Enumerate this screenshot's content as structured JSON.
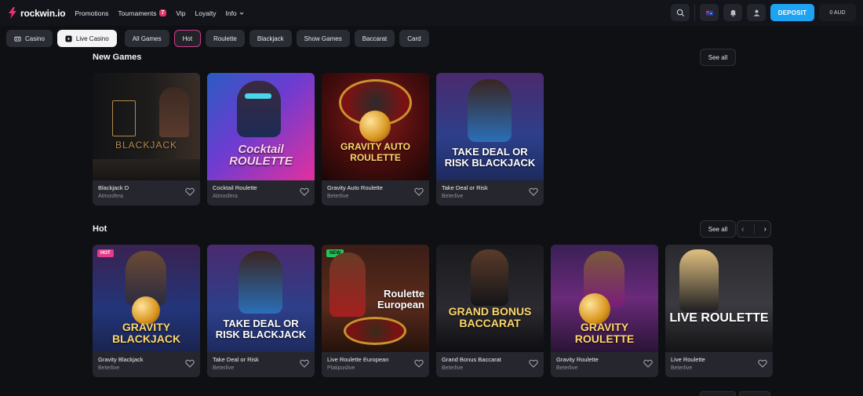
{
  "brand": {
    "name": "rockwin.io",
    "accent": "#e5336e",
    "primary": "#1ea3f2"
  },
  "nav": {
    "promotions": "Promotions",
    "tournaments": "Tournaments",
    "tournaments_badge": "7",
    "vip": "Vip",
    "loyalty": "Loyalty",
    "info": "Info"
  },
  "header": {
    "deposit": "DEPOSIT",
    "balance": "0 AUD"
  },
  "filters": {
    "casino": "Casino",
    "live_casino": "Live Casino",
    "all_games": "All Games",
    "hot": "Hot",
    "roulette": "Roulette",
    "blackjack": "Blackjack",
    "show_games": "Show Games",
    "baccarat": "Baccarat",
    "card": "Card"
  },
  "sections": {
    "new_games": {
      "title": "New Games",
      "see_all": "See all",
      "games": [
        {
          "name": "Blackjack D",
          "provider": "Atmosfera",
          "art": "BLACKJACK"
        },
        {
          "name": "Cocktail Roulette",
          "provider": "Atmosfera",
          "art": "Cocktail ROULETTE"
        },
        {
          "name": "Gravity Auto Roulette",
          "provider": "Beterlive",
          "art": "GRAVITY AUTO ROULETTE"
        },
        {
          "name": "Take Deal or Risk",
          "provider": "Beterlive",
          "art": "TAKE DEAL OR RISK BLACKJACK"
        }
      ]
    },
    "hot": {
      "title": "Hot",
      "see_all": "See all",
      "pager_prev": "‹",
      "pager_next": "›",
      "games": [
        {
          "name": "Gravity Blackjack",
          "provider": "Beterlive",
          "badge": "HOT",
          "art": "GRAVITY BLACKJACK"
        },
        {
          "name": "Take Deal or Risk",
          "provider": "Beterlive",
          "badge": "",
          "art": "TAKE DEAL OR RISK BLACKJACK"
        },
        {
          "name": "Live Roulette European",
          "provider": "Platipuslive",
          "badge": "NEW",
          "art": "Roulette European"
        },
        {
          "name": "Grand Bonus Baccarat",
          "provider": "Beterlive",
          "badge": "",
          "art": "GRAND BONUS BACCARAT"
        },
        {
          "name": "Gravity Roulette",
          "provider": "Beterlive",
          "badge": "",
          "art": "GRAVITY ROULETTE"
        },
        {
          "name": "Live Roulette",
          "provider": "Beterlive",
          "badge": "",
          "art": "LIVE ROULETTE"
        }
      ]
    }
  }
}
